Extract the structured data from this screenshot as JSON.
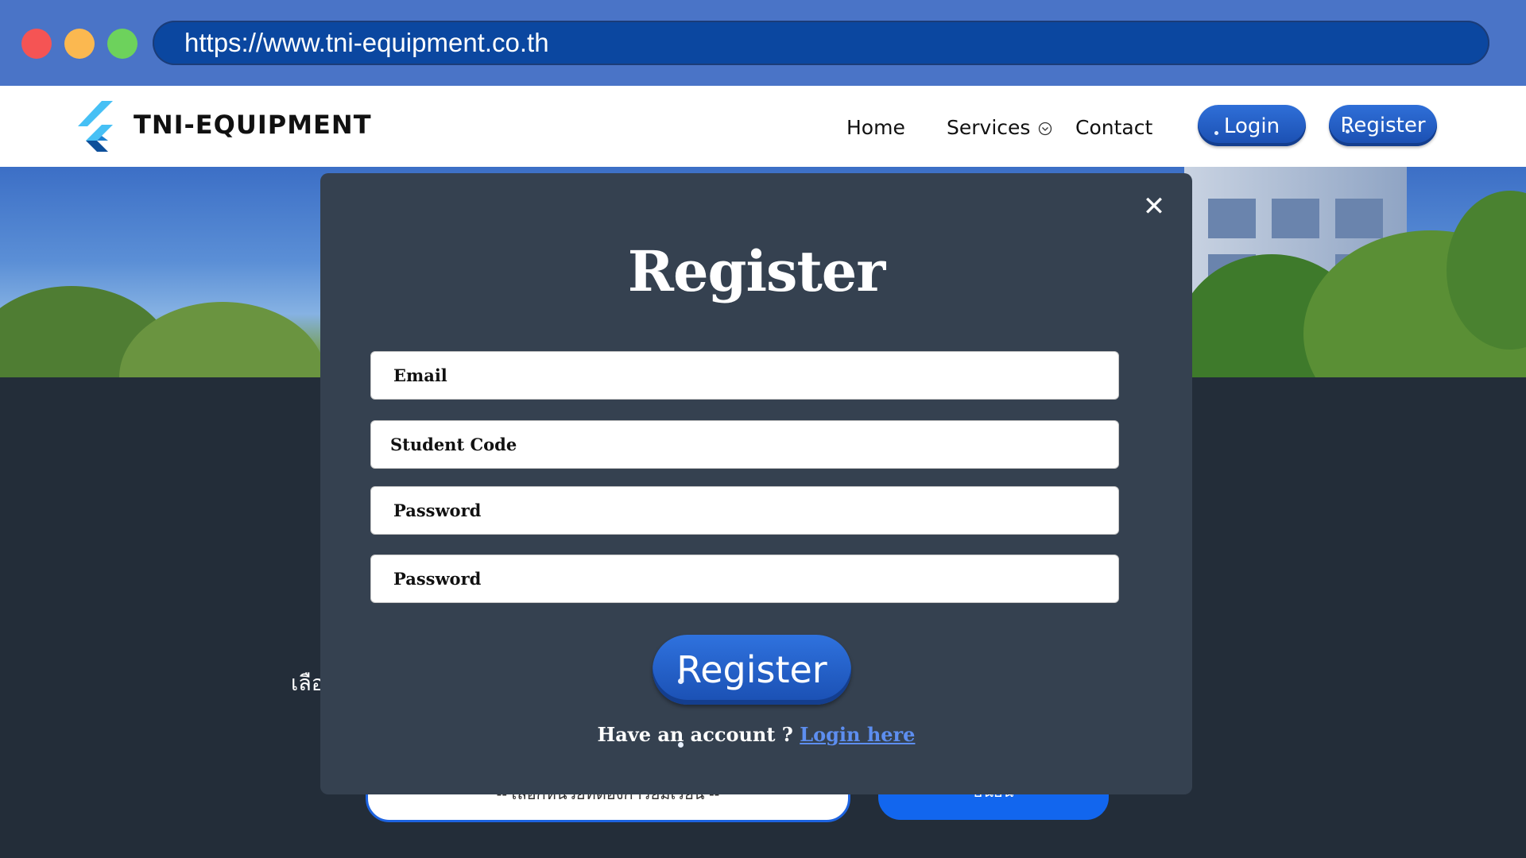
{
  "browser": {
    "url": "https://www.tni-equipment.co.th"
  },
  "site": {
    "brand": "TNI-EQUIPMENT",
    "nav": {
      "home": "Home",
      "services": "Services",
      "contact": "Contact",
      "login": "Login",
      "register": "Register"
    }
  },
  "background": {
    "thai_label": "เลือ",
    "select_text": "-- เลือกหน่วยที่ต้องการยืมเรียน --",
    "submit_text": "ยืนยัน"
  },
  "modal": {
    "title": "Register",
    "close_icon": "close-icon",
    "fields": {
      "email_placeholder": "Email",
      "student_code_placeholder": "Student Code",
      "password_placeholder": "Password",
      "confirm_password_placeholder": "Password"
    },
    "submit_label": "Register",
    "account_prompt": "Have an account ?",
    "login_link": "Login here"
  },
  "colors": {
    "chrome": "#4a74c7",
    "urlbar": "#0b47a0",
    "modal": "#354150",
    "page_bg": "#232d39",
    "accent": "#1a4eb0",
    "link": "#5d8ef0"
  }
}
